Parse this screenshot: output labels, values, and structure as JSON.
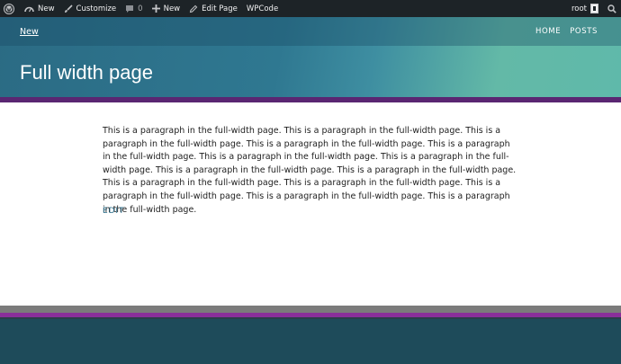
{
  "adminbar": {
    "items": [
      {
        "label": "New",
        "icon": "dashboard-icon"
      },
      {
        "label": "Customize",
        "icon": "brush-icon"
      },
      {
        "label": "0",
        "icon": "comment-icon"
      },
      {
        "label": "New",
        "icon": "plus-icon"
      },
      {
        "label": "Edit Page",
        "icon": "pencil-icon"
      },
      {
        "label": "WPCode",
        "icon": ""
      }
    ],
    "user": "root"
  },
  "header": {
    "site_link": "New",
    "nav": [
      "HOME",
      "POSTS"
    ],
    "page_title": "Full width page"
  },
  "content": {
    "paragraph": "This is a paragraph in the full-width page. This is a paragraph in the full-width page. This is a paragraph in the full-width page. This is a paragraph in the full-width page. This is a paragraph in the full-width page. This is a paragraph in the full-width page. This is a paragraph in the full-width page. This is a paragraph in the full-width page. This is a paragraph in the full-width page. This is a paragraph in the full-width page. This is a paragraph in the full-width page. This is a paragraph in the full-width page. This is a paragraph in the full-width page. This is a paragraph in the full-width page.",
    "edit_label": "EDIT"
  },
  "colors": {
    "adminbar_bg": "#1d2327",
    "header_start": "#2b6b84",
    "header_end": "#5fb9aa",
    "stripe_purple": "#5a2672",
    "link": "#2d6f8b",
    "footer_teal": "#1e4b5a"
  }
}
